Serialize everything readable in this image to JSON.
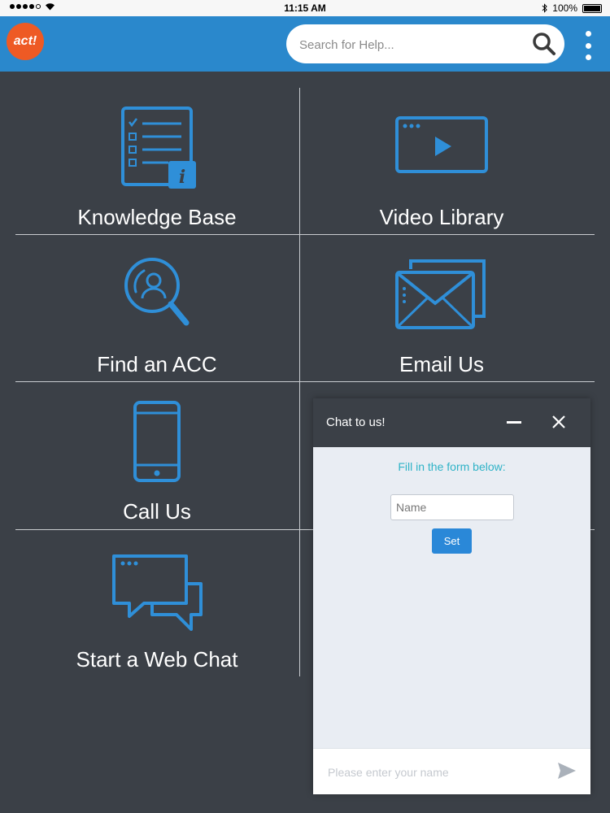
{
  "status_bar": {
    "time": "11:15 AM",
    "battery": "100%",
    "signal_icon": "signal-dots-icon",
    "wifi_icon": "wifi-icon",
    "bluetooth_icon": "bluetooth-icon"
  },
  "header": {
    "logo_text": "act!",
    "search": {
      "placeholder": "Search for Help..."
    },
    "search_icon": "search-icon",
    "menu_icon": "more-vertical-icon"
  },
  "tiles": [
    {
      "label": "Knowledge Base",
      "icon": "knowledge-base-icon"
    },
    {
      "label": "Video Library",
      "icon": "video-player-icon"
    },
    {
      "label": "Find an ACC",
      "icon": "find-person-icon"
    },
    {
      "label": "Email Us",
      "icon": "envelope-icon"
    },
    {
      "label": "Call Us",
      "icon": "smartphone-icon"
    },
    {
      "label": "Start a Web Chat",
      "icon": "chat-bubbles-icon"
    }
  ],
  "chat": {
    "title": "Chat to us!",
    "prompt": "Fill in the form below:",
    "name_placeholder": "Name",
    "set_label": "Set",
    "message_placeholder": "Please enter your name",
    "minimize_icon": "minimize-icon",
    "close_icon": "close-icon",
    "send_icon": "send-icon"
  },
  "colors": {
    "background": "#3b4047",
    "header": "#2a88cc",
    "icon_blue": "#2f8fd8",
    "logo": "#ee5a24",
    "prompt_teal": "#2fb3c7",
    "button_blue": "#2a88d8"
  }
}
